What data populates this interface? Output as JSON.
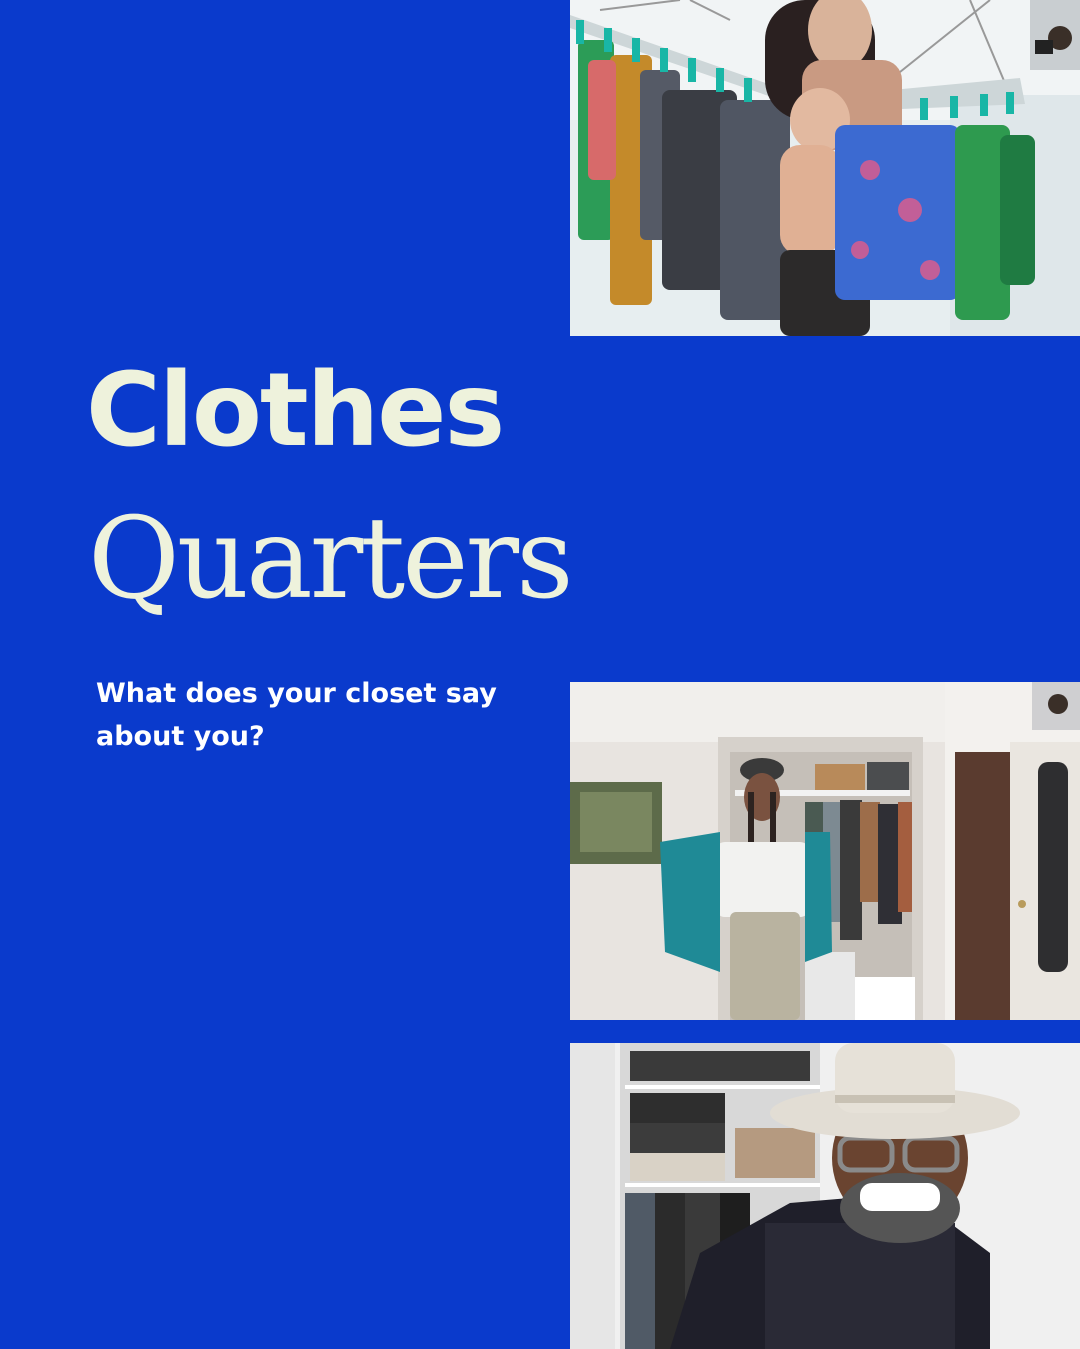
{
  "title": {
    "line1": "Clothes",
    "line2": "Quarters"
  },
  "subtitle": "What does your closet say about you?",
  "colors": {
    "background": "#0a3acc",
    "title_text": "#eef2dc",
    "subtitle_text": "#ffffff"
  },
  "photos": [
    {
      "name": "video-call-photo-drying-rack"
    },
    {
      "name": "video-call-photo-closet-jacket"
    },
    {
      "name": "video-call-photo-hat-smiling"
    }
  ]
}
